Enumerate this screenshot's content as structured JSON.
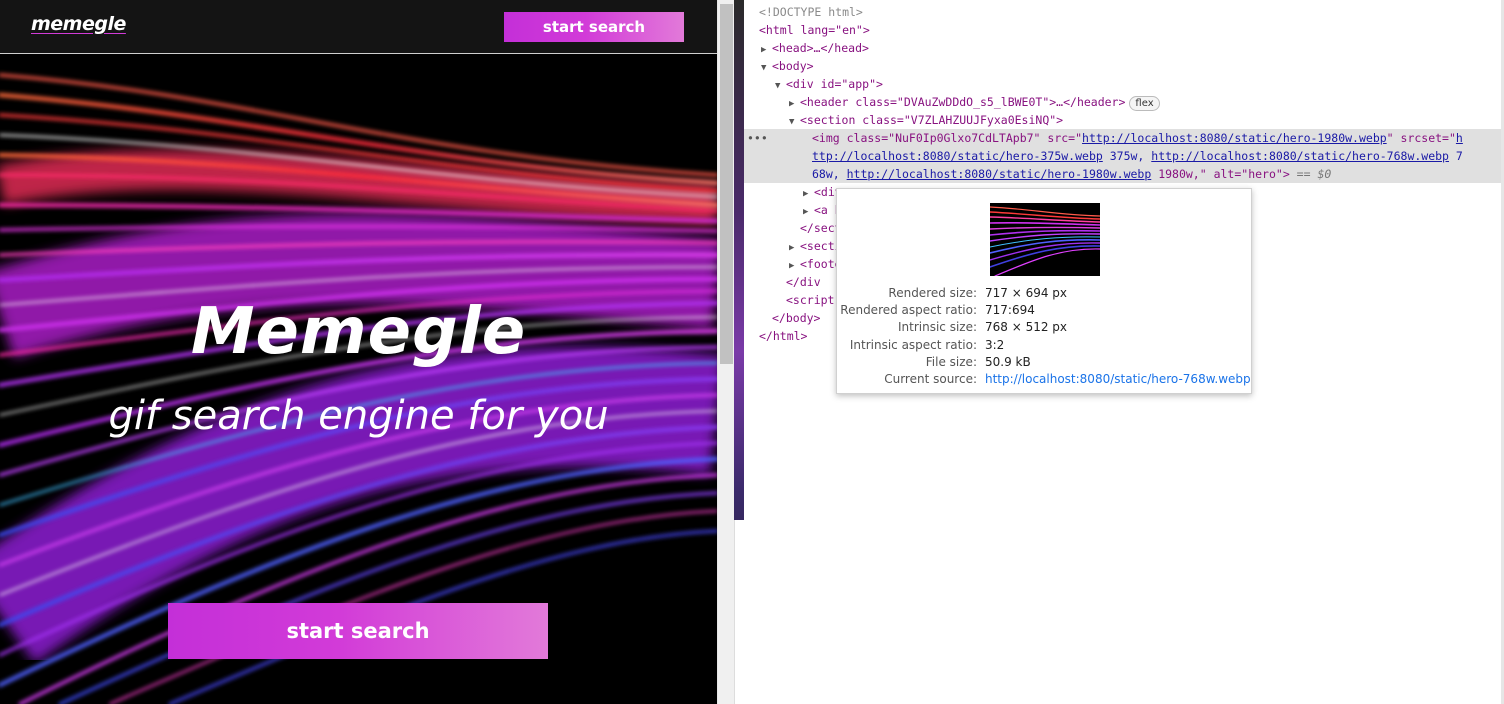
{
  "site": {
    "logo": "memegle",
    "header_button": "start search",
    "hero_title": "Memegle",
    "hero_subtitle": "gif search engine for you",
    "hero_button": "start search"
  },
  "colors": {
    "button_gradient_start": "#c42fd8",
    "button_gradient_end": "#e27ad9",
    "header_bg": "#141414"
  },
  "devtools": {
    "doctype": "<!DOCTYPE html>",
    "html_open": "<html lang=\"en\">",
    "head": "<head>…</head>",
    "body_open": "<body>",
    "app_div": "<div id=\"app\">",
    "header_tag": "<header class=\"DVAuZwDDdO_s5_lBWE0T\">…</header>",
    "flex_badge": "flex",
    "section_tag": "<section class=\"V7ZLAHZUUJFyxa0EsiNQ\">",
    "img_line1_prefix": "<img class=\"NuF0Ip0Glxo7CdLTApb7\" src=\"",
    "img_src": "http://localhost:8080/static/hero-1980w.webp",
    "img_line1_mid": "\" srcset=\"",
    "img_line1_tail": "h",
    "img_line2_url1": "ttp://localhost:8080/static/hero-375w.webp",
    "img_line2_mid1": " 375w, ",
    "img_line2_url2": "http://localhost:8080/static/hero-768w.webp",
    "img_line2_tail": " 7",
    "img_line3_head": "68w, ",
    "img_line3_url3": "http://localhost:8080/static/hero-1980w.webp",
    "img_line3_mid": " 1980w,\" alt=\"hero\">",
    "img_line3_eq": " == $0",
    "div_partial": "<div",
    "a_partial": "<a h",
    "sect_close_partial": "</sect",
    "section_partial": "<secti",
    "footer_partial": "<foote",
    "div_close": "</div",
    "script_partial": "<script",
    "body_close": "</body>",
    "html_close": "</html>"
  },
  "tooltip": {
    "rows": [
      {
        "key": "Rendered size:",
        "value": "717 × 694 px"
      },
      {
        "key": "Rendered aspect ratio:",
        "value": "717:694"
      },
      {
        "key": "Intrinsic size:",
        "value": "768 × 512 px"
      },
      {
        "key": "Intrinsic aspect ratio:",
        "value": "3:2"
      },
      {
        "key": "File size:",
        "value": "50.9 kB"
      },
      {
        "key": "Current source:",
        "value": "http://localhost:8080/static/hero-768w.webp"
      }
    ]
  }
}
